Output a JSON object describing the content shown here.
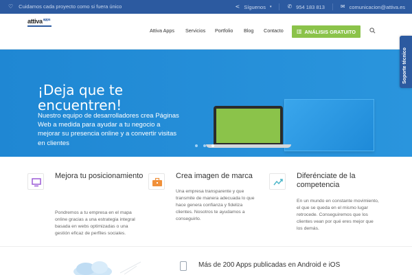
{
  "topbar": {
    "slogan": "Cuidamos cada proyecto como si fuera único",
    "social_label": "Síguenos",
    "phone": "954 183 813",
    "email": "comunicacion@attiva.es"
  },
  "header": {
    "logo_text": "attiva",
    "logo_sub": "apps",
    "nav": [
      "Attiva Apps",
      "Servicios",
      "Portfolio",
      "Blog",
      "Contacto"
    ],
    "cta_label": "ANÁLISIS GRATUITO"
  },
  "support_tab": "Soporte técnico",
  "hero": {
    "title": "¡Deja que te encuentren!",
    "subtitle": "Nuestro equipo de desarrolladores crea Páginas Web a medida para ayudar a tu negocio a mejorar su presencia online y a convertir visitas",
    "subtitle_end": "en clientes",
    "slides_count": 3,
    "active_slide": 3
  },
  "features": [
    {
      "title": "Mejora tu posicionamiento",
      "text": "Pondremos a tu empresa en el mapa online gracias a una estrategia integral basada en webs optimizadas o una gestión eficaz de perfiles sociales.",
      "icon": "monitor-icon",
      "color": "#9c5ad6"
    },
    {
      "title": "Crea imagen de marca",
      "text": "Una empresa transparente y que transmite de manera adecuada lo que hace genera confianza y fideliza clientes. Nosotros te ayudamos a conseguirlo.",
      "icon": "briefcase-icon",
      "color": "#f0903a"
    },
    {
      "title": "Diferénciate de la competencia",
      "text": "En un mundo en constante movimiento, el que se queda en el mismo lugar retrocede. Conseguiremos que los clientes vean por qué eres mejor que los demás.",
      "icon": "trend-icon",
      "color": "#4fb7c9"
    }
  ],
  "apps_section": {
    "headline": "Más de 200 Apps publicadas en Android e iOS"
  },
  "colors": {
    "topbar": "#2c5aa0",
    "hero": "#2a95dd",
    "accent_green": "#8bc34a"
  }
}
